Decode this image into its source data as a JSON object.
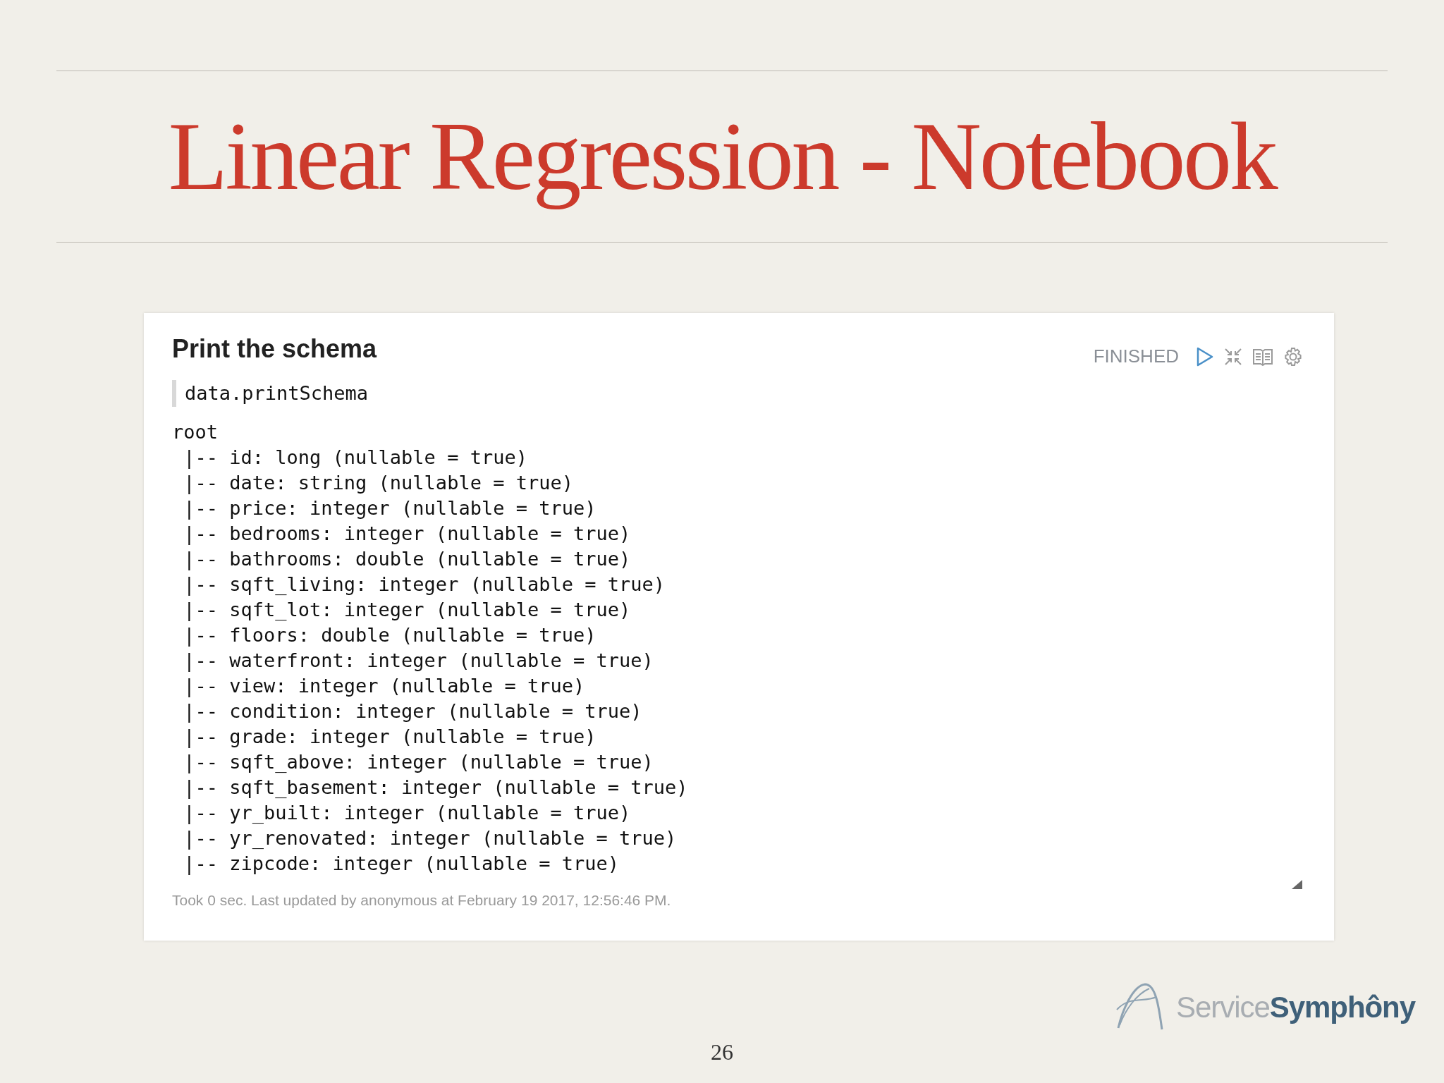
{
  "slide": {
    "title": "Linear Regression - Notebook",
    "page_number": "26"
  },
  "paragraph": {
    "title": "Print the schema",
    "status": "FINISHED",
    "code": "data.printSchema",
    "output": [
      "root",
      " |-- id: long (nullable = true)",
      " |-- date: string (nullable = true)",
      " |-- price: integer (nullable = true)",
      " |-- bedrooms: integer (nullable = true)",
      " |-- bathrooms: double (nullable = true)",
      " |-- sqft_living: integer (nullable = true)",
      " |-- sqft_lot: integer (nullable = true)",
      " |-- floors: double (nullable = true)",
      " |-- waterfront: integer (nullable = true)",
      " |-- view: integer (nullable = true)",
      " |-- condition: integer (nullable = true)",
      " |-- grade: integer (nullable = true)",
      " |-- sqft_above: integer (nullable = true)",
      " |-- sqft_basement: integer (nullable = true)",
      " |-- yr_built: integer (nullable = true)",
      " |-- yr_renovated: integer (nullable = true)",
      " |-- zipcode: integer (nullable = true)"
    ],
    "footer": "Took 0 sec. Last updated by anonymous at February 19 2017, 12:56:46 PM."
  },
  "logo": {
    "text": "Service**Symphôny**"
  }
}
